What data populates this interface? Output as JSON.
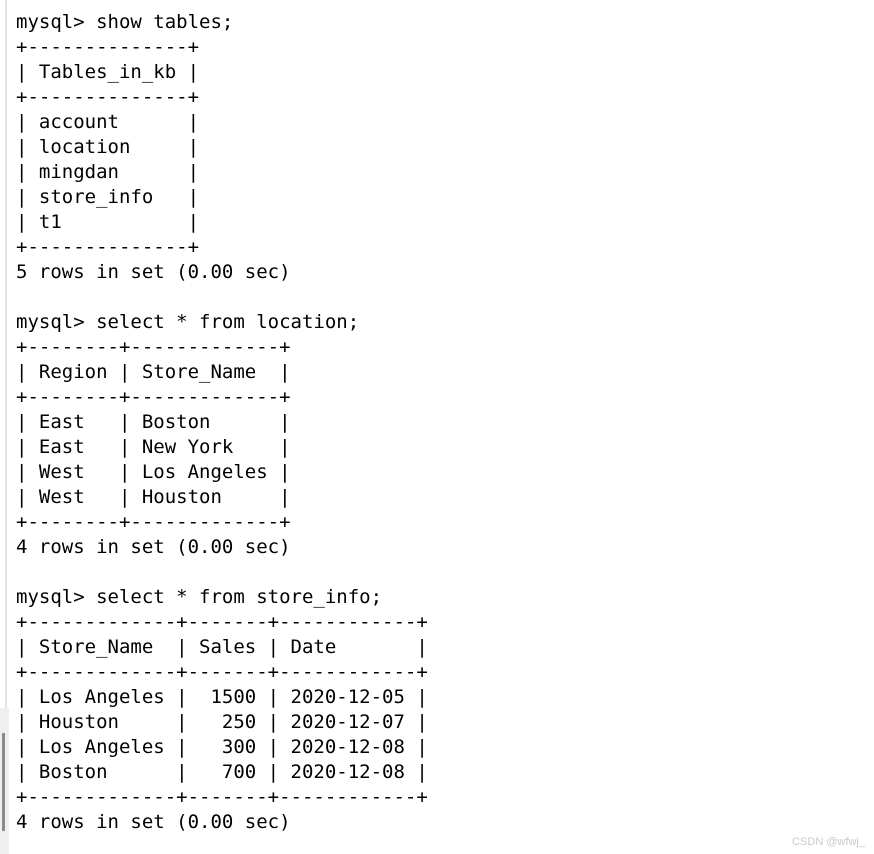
{
  "terminal": {
    "prompt": "mysql> ",
    "blocks": [
      {
        "name": "show-tables",
        "command": "mysql> show tables;",
        "lines": [
          "mysql> show tables;",
          "+--------------+",
          "| Tables_in_kb |",
          "+--------------+",
          "| account      |",
          "| location     |",
          "| mingdan      |",
          "| store_info   |",
          "| t1           |",
          "+--------------+",
          "5 rows in set (0.00 sec)"
        ],
        "result": {
          "headers": [
            "Tables_in_kb"
          ],
          "rows": [
            [
              "account"
            ],
            [
              "location"
            ],
            [
              "mingdan"
            ],
            [
              "store_info"
            ],
            [
              "t1"
            ]
          ],
          "status": "5 rows in set (0.00 sec)"
        }
      },
      {
        "name": "select-location",
        "command": "mysql> select * from location;",
        "lines": [
          "mysql> select * from location;",
          "+--------+-------------+",
          "| Region | Store_Name  |",
          "+--------+-------------+",
          "| East   | Boston      |",
          "| East   | New York    |",
          "| West   | Los Angeles |",
          "| West   | Houston     |",
          "+--------+-------------+",
          "4 rows in set (0.00 sec)"
        ],
        "result": {
          "headers": [
            "Region",
            "Store_Name"
          ],
          "rows": [
            [
              "East",
              "Boston"
            ],
            [
              "East",
              "New York"
            ],
            [
              "West",
              "Los Angeles"
            ],
            [
              "West",
              "Houston"
            ]
          ],
          "status": "4 rows in set (0.00 sec)"
        }
      },
      {
        "name": "select-store-info",
        "command": "mysql> select * from store_info;",
        "lines": [
          "mysql> select * from store_info;",
          "+-------------+-------+------------+",
          "| Store_Name  | Sales | Date       |",
          "+-------------+-------+------------+",
          "| Los Angeles |  1500 | 2020-12-05 |",
          "| Houston     |   250 | 2020-12-07 |",
          "| Los Angeles |   300 | 2020-12-08 |",
          "| Boston      |   700 | 2020-12-08 |",
          "+-------------+-------+------------+",
          "4 rows in set (0.00 sec)"
        ],
        "result": {
          "headers": [
            "Store_Name",
            "Sales",
            "Date"
          ],
          "rows": [
            [
              "Los Angeles",
              "1500",
              "2020-12-05"
            ],
            [
              "Houston",
              "250",
              "2020-12-07"
            ],
            [
              "Los Angeles",
              "300",
              "2020-12-08"
            ],
            [
              "Boston",
              "700",
              "2020-12-08"
            ]
          ],
          "status": "4 rows in set (0.00 sec)"
        }
      }
    ]
  },
  "watermark": {
    "text": "CSDN @wfwj_"
  },
  "colors": {
    "background": "#ffffff",
    "text": "#000000",
    "left_rule": "#e3e3e3",
    "left_panel": "#efefef",
    "scroll_thumb": "#8a8a8a",
    "watermark": "#c9c9c9"
  }
}
